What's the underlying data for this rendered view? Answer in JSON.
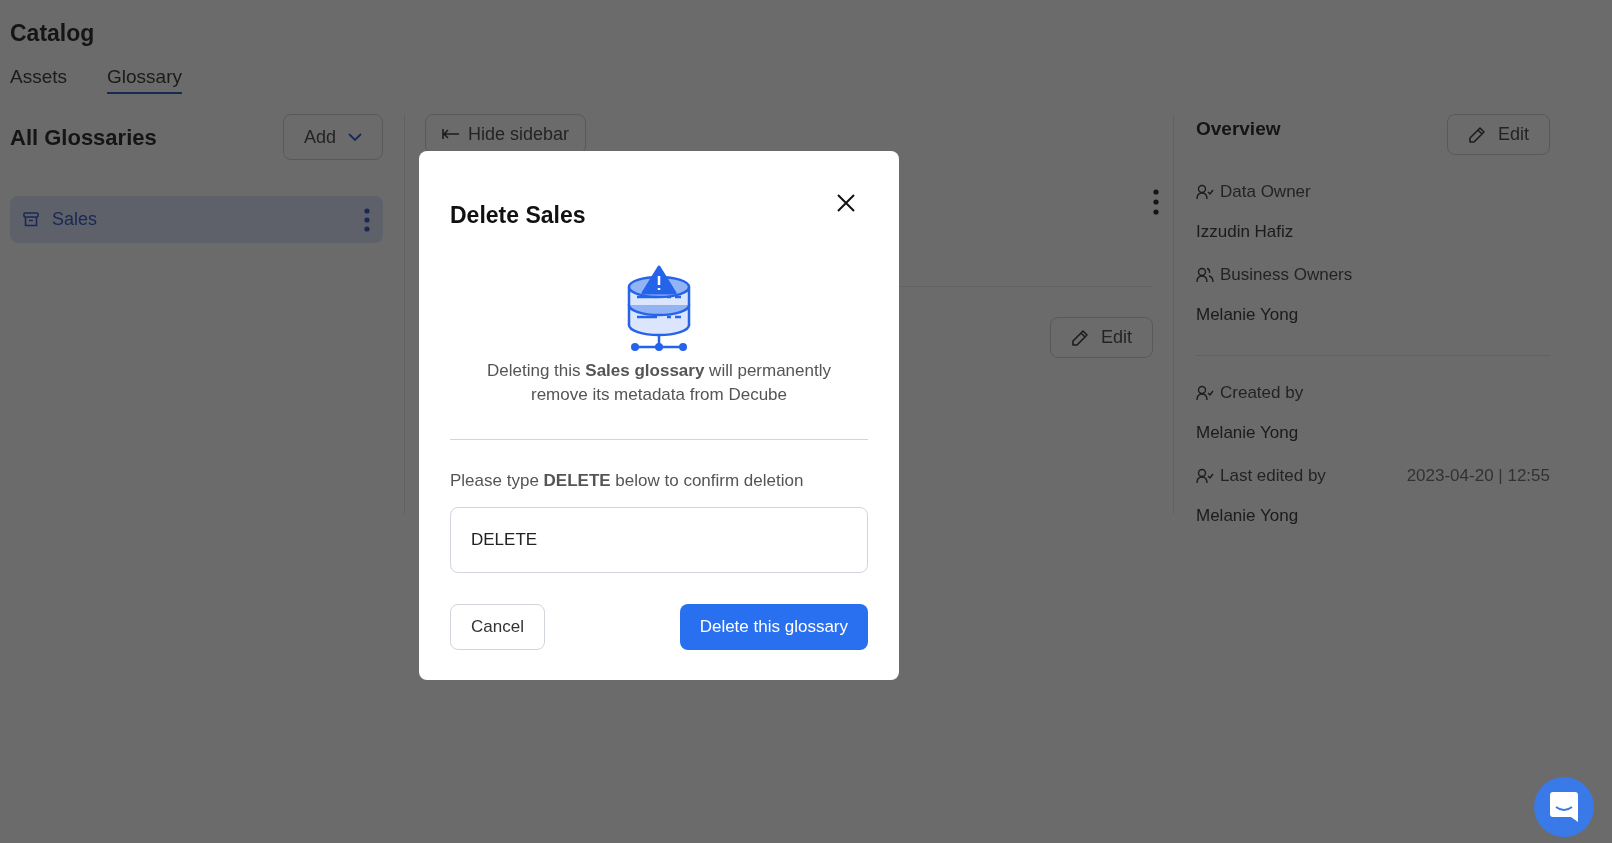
{
  "page": {
    "title": "Catalog",
    "tabs": [
      {
        "label": "Assets",
        "selected": false
      },
      {
        "label": "Glossary",
        "selected": true
      }
    ]
  },
  "sidebar": {
    "title": "All Glossaries",
    "add_button": "Add",
    "items": [
      {
        "label": "Sales",
        "selected": true
      }
    ]
  },
  "main": {
    "hide_sidebar_button": "Hide sidebar",
    "edit_button": "Edit"
  },
  "overview": {
    "title": "Overview",
    "edit_button": "Edit",
    "sections": [
      [
        {
          "kind": "user",
          "label": "Data Owner",
          "value": "Izzudin Hafiz"
        },
        {
          "kind": "users",
          "label": "Business Owners",
          "value": "Melanie Yong"
        }
      ],
      [
        {
          "kind": "user",
          "label": "Created by",
          "value": "Melanie Yong"
        },
        {
          "kind": "user",
          "label": "Last edited by",
          "date": "2023-04-20 | 12:55",
          "value": "Melanie Yong"
        }
      ]
    ]
  },
  "dialog": {
    "title": "Delete Sales",
    "message": "Deleting this **Sales glossary** will permanently remove its metadata from Decube",
    "prompt": "Please type **DELETE** below to confirm deletion",
    "input_value": "DELETE",
    "cancel_button": "Cancel",
    "confirm_button": "Delete this glossary"
  }
}
